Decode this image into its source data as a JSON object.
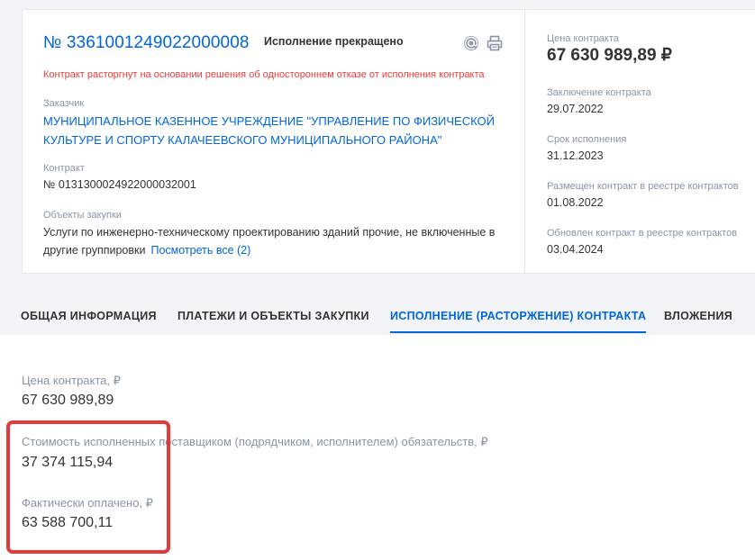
{
  "contract": {
    "number": "№ 3361001249022000008",
    "status": "Исполнение прекращено",
    "terminated_note": "Контракт расторгнут на основании решения об одностороннем отказе от исполнения контракта",
    "customer_label": "Заказчик",
    "customer_name": "МУНИЦИПАЛЬНОЕ КАЗЕННОЕ УЧРЕЖДЕНИЕ \"УПРАВЛЕНИЕ ПО ФИЗИЧЕСКОЙ КУЛЬТУРЕ И СПОРТУ КАЛАЧЕЕВСКОГО МУНИЦИПАЛЬНОГО РАЙОНА\"",
    "contract_label": "Контракт",
    "contract_value": "№ 0131300024922000032001",
    "objects_label": "Объекты закупки",
    "objects_text": "Услуги по инженерно-техническому проектированию зданий прочие, не включенные в другие группировки",
    "see_all": "Посмотреть все (2)"
  },
  "summary": {
    "price_label": "Цена контракта",
    "price_value": "67 630 989,89 ₽",
    "conclusion_label": "Заключение контракта",
    "conclusion_date": "29.07.2022",
    "term_label": "Срок исполнения",
    "term_date": "31.12.2023",
    "registry_label": "Размещен контракт в реестре контрактов",
    "registry_date": "01.08.2022",
    "updated_label": "Обновлен контракт в реестре контрактов",
    "updated_date": "03.04.2024"
  },
  "icons": {
    "mail": "at-sign-icon",
    "print": "printer-icon"
  },
  "tabs": [
    {
      "label": "ОБЩАЯ ИНФОРМАЦИЯ",
      "active": false
    },
    {
      "label": "ПЛАТЕЖИ И ОБЪЕКТЫ ЗАКУПКИ",
      "active": false
    },
    {
      "label": "ИСПОЛНЕНИЕ (РАСТОРЖЕНИЕ) КОНТРАКТА",
      "active": true
    },
    {
      "label": "ВЛОЖЕНИЯ",
      "active": false
    }
  ],
  "execution": {
    "price_label": "Цена контракта, ₽",
    "price_value": "67 630 989,89",
    "executed_label": "Стоимость исполненных поставщиком (подрядчиком, исполнителем) обязательств, ₽",
    "executed_value": "37 374 115,94",
    "paid_label": "Фактически оплачено, ₽",
    "paid_value": "63 588 700,11"
  },
  "colors": {
    "link": "#0065dd",
    "alert": "#eb3b3b",
    "highlight": "#e23b3b",
    "label": "#8a94a6",
    "background": "#f2f4f8"
  }
}
